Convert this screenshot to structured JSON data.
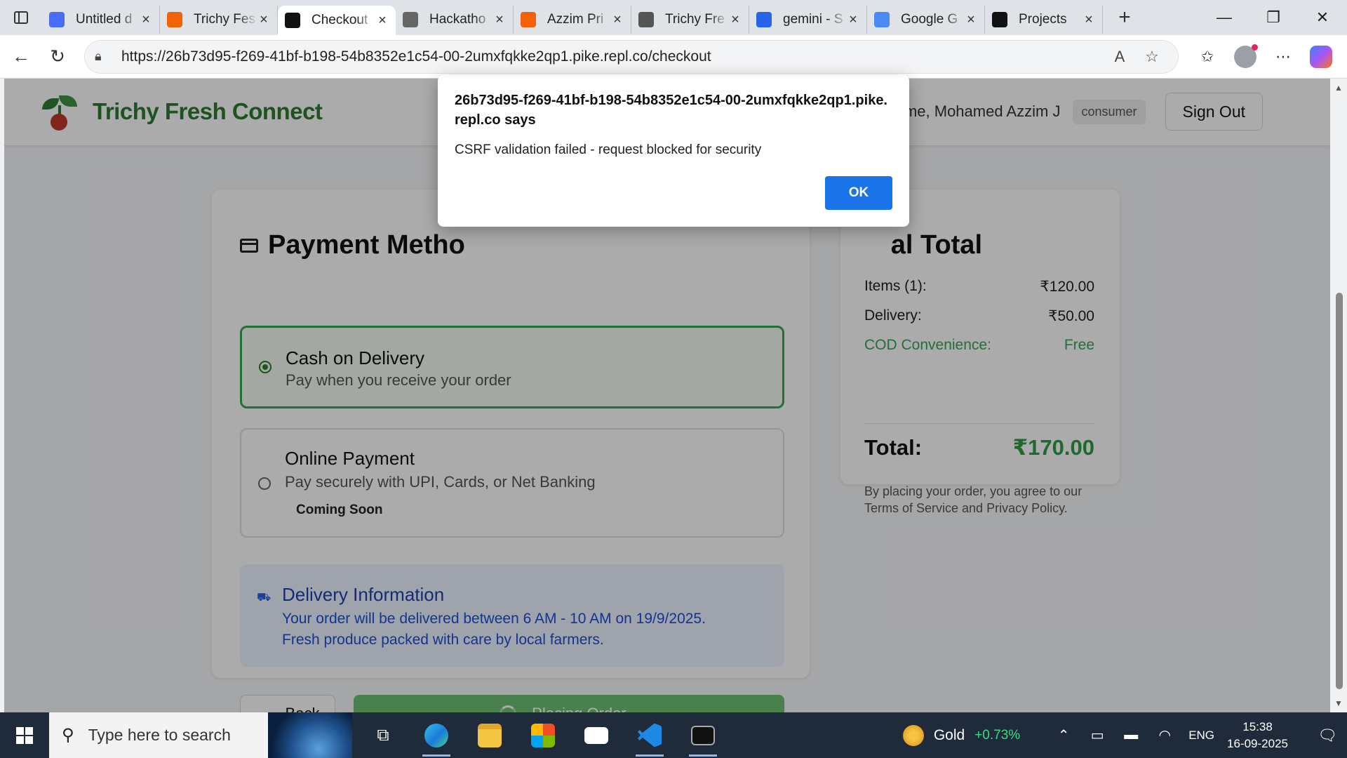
{
  "browser": {
    "tabs": [
      {
        "label": "Untitled d",
        "icon": "docs-icon",
        "color": "#4a6cf7"
      },
      {
        "label": "Trichy Fes",
        "icon": "replit-icon",
        "color": "#f26207"
      },
      {
        "label": "Checkout",
        "icon": "checkout-icon",
        "color": "#111111",
        "active": true
      },
      {
        "label": "Hackatho",
        "icon": "hackathon-icon",
        "color": "#666666"
      },
      {
        "label": "Azzim Pri",
        "icon": "replit-icon",
        "color": "#f26207"
      },
      {
        "label": "Trichy Fre",
        "icon": "globe-icon",
        "color": "#555555"
      },
      {
        "label": "gemini - S",
        "icon": "search-icon",
        "color": "#2563eb"
      },
      {
        "label": "Google G",
        "icon": "gemini-icon",
        "color": "#4a8af4"
      },
      {
        "label": "Projects",
        "icon": "github-icon",
        "color": "#111111"
      }
    ],
    "url": "https://26b73d95-f269-41bf-b198-54b8352e1c54-00-2umxfqkke2qp1.pike.repl.co/checkout"
  },
  "header": {
    "brand": "Trichy Fresh Connect",
    "welcome": "lcome, Mohamed Azzim J",
    "role": "consumer",
    "sign_out": "Sign Out"
  },
  "payment": {
    "title": "Payment Metho",
    "options": [
      {
        "title": "Cash on Delivery",
        "subtitle": "Pay when you receive your order",
        "selected": true
      },
      {
        "title": "Online Payment",
        "subtitle": "Pay securely with UPI, Cards, or Net Banking",
        "badge": "Coming Soon",
        "selected": false
      }
    ],
    "delivery": {
      "title": "Delivery Information",
      "line1": "Your order will be delivered between 6 AM - 10 AM on 19/9/2025.",
      "line2": "Fresh produce packed with care by local farmers."
    },
    "back": "Back",
    "placing": "Placing Order..."
  },
  "summary": {
    "title": "al Total",
    "items_label": "Items (1):",
    "items_value": "₹120.00",
    "delivery_label": "Delivery:",
    "delivery_value": "₹50.00",
    "cod_label": "COD Convenience:",
    "cod_value": "Free",
    "total_label": "Total:",
    "total_value": "₹170.00",
    "terms": "By placing your order, you agree to our Terms of Service and Privacy Policy."
  },
  "dialog": {
    "title": "26b73d95-f269-41bf-b198-54b8352e1c54-00-2umxfqkke2qp1.pike.repl.co says",
    "message": "CSRF validation failed - request blocked for security",
    "ok": "OK"
  },
  "taskbar": {
    "search_placeholder": "Type here to search",
    "ticker_name": "Gold",
    "ticker_change": "+0.73%",
    "lang": "ENG",
    "time": "15:38",
    "date": "16-09-2025"
  }
}
